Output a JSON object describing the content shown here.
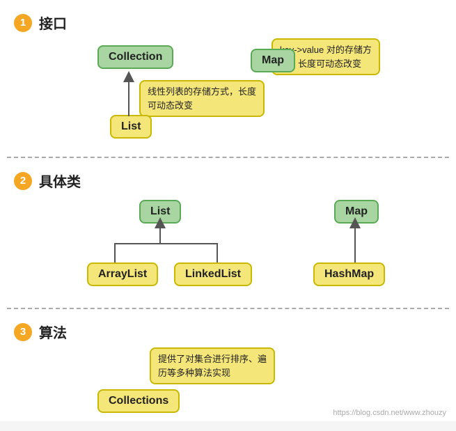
{
  "section1": {
    "num": "1",
    "title": "接口",
    "collection_label": "Collection",
    "map_label": "Map",
    "list_label": "List",
    "tooltip_list": "线性列表的存储方式，长度\n可动态改变",
    "tooltip_map": "key->value 对的存储方\n式，长度可动态改变"
  },
  "section2": {
    "num": "2",
    "title": "具体类",
    "list_label": "List",
    "map_label": "Map",
    "arraylist_label": "ArrayList",
    "linkedlist_label": "LinkedList",
    "hashmap_label": "HashMap"
  },
  "section3": {
    "num": "3",
    "title": "算法",
    "collections_label": "Collections",
    "tooltip": "提供了对集合进行排序、遍\n历等多种算法实现"
  },
  "watermark": "https://blog.csdn.net/www.zhouzy"
}
